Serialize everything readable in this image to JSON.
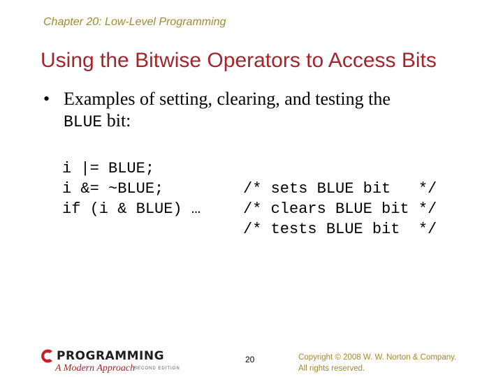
{
  "header": {
    "chapter": "Chapter 20: Low-Level Programming"
  },
  "slide": {
    "title": "Using the Bitwise Operators to Access Bits",
    "bullet": {
      "symbol": "•",
      "text_before": "Examples of setting, clearing, and testing the",
      "code_word": "BLUE",
      "text_after": " bit:"
    },
    "code_lines": [
      {
        "statement": "i |= BLUE;",
        "comment": "/* sets BLUE bit   */"
      },
      {
        "statement": "i &= ~BLUE;",
        "comment": "/* clears BLUE bit */"
      },
      {
        "statement": "if (i & BLUE) …",
        "comment": "/* tests BLUE bit  */"
      }
    ]
  },
  "footer": {
    "logo": {
      "letter": "C",
      "word": "PROGRAMMING",
      "subtitle": "A Modern Approach",
      "edition": "SECOND EDITION"
    },
    "page_number": "20",
    "copyright_line1": "Copyright © 2008 W. W. Norton & Company.",
    "copyright_line2": "All rights reserved."
  },
  "colors": {
    "title": "#a2262b",
    "header": "#a08a2c",
    "copyright": "#a08a2c"
  }
}
